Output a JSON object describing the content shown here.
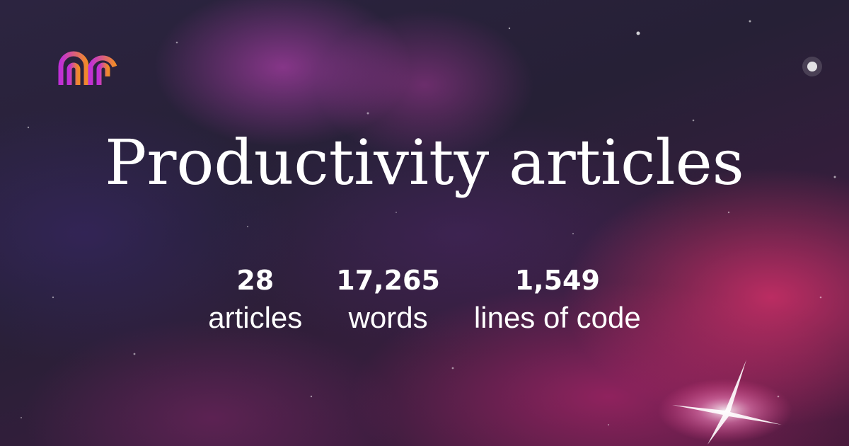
{
  "logo": {
    "icon": "arch-logo-icon",
    "gradient_start": "#c02fd8",
    "gradient_end": "#f08a2a"
  },
  "title": "Productivity articles",
  "stats": [
    {
      "value": "28",
      "label": "articles"
    },
    {
      "value": "17,265",
      "label": "words"
    },
    {
      "value": "1,549",
      "label": "lines of code"
    }
  ],
  "colors": {
    "text": "#ffffff",
    "background_dark": "#262036",
    "nebula_pink": "#e6326e",
    "nebula_magenta": "#d246c8"
  }
}
